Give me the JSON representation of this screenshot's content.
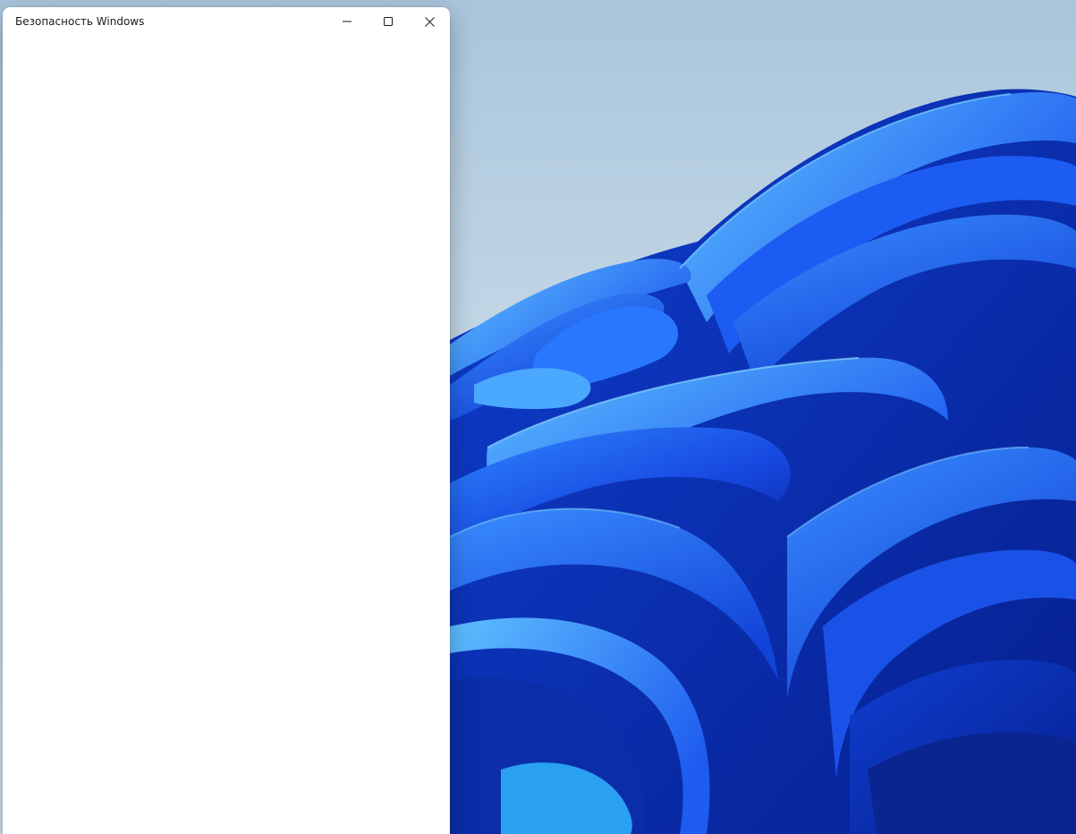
{
  "window": {
    "title": "Безопасность Windows",
    "controls": {
      "minimize_icon": "minimize-icon",
      "maximize_icon": "maximize-icon",
      "close_icon": "close-icon"
    }
  },
  "desktop": {
    "wallpaper": "windows-11-bloom",
    "colors": {
      "sky_top": "#a9c5dc",
      "sky_bottom": "#d2e1ec",
      "bloom_dark": "#0a2fb0",
      "bloom_mid": "#1f63ef",
      "bloom_light": "#3ea6ff"
    }
  }
}
